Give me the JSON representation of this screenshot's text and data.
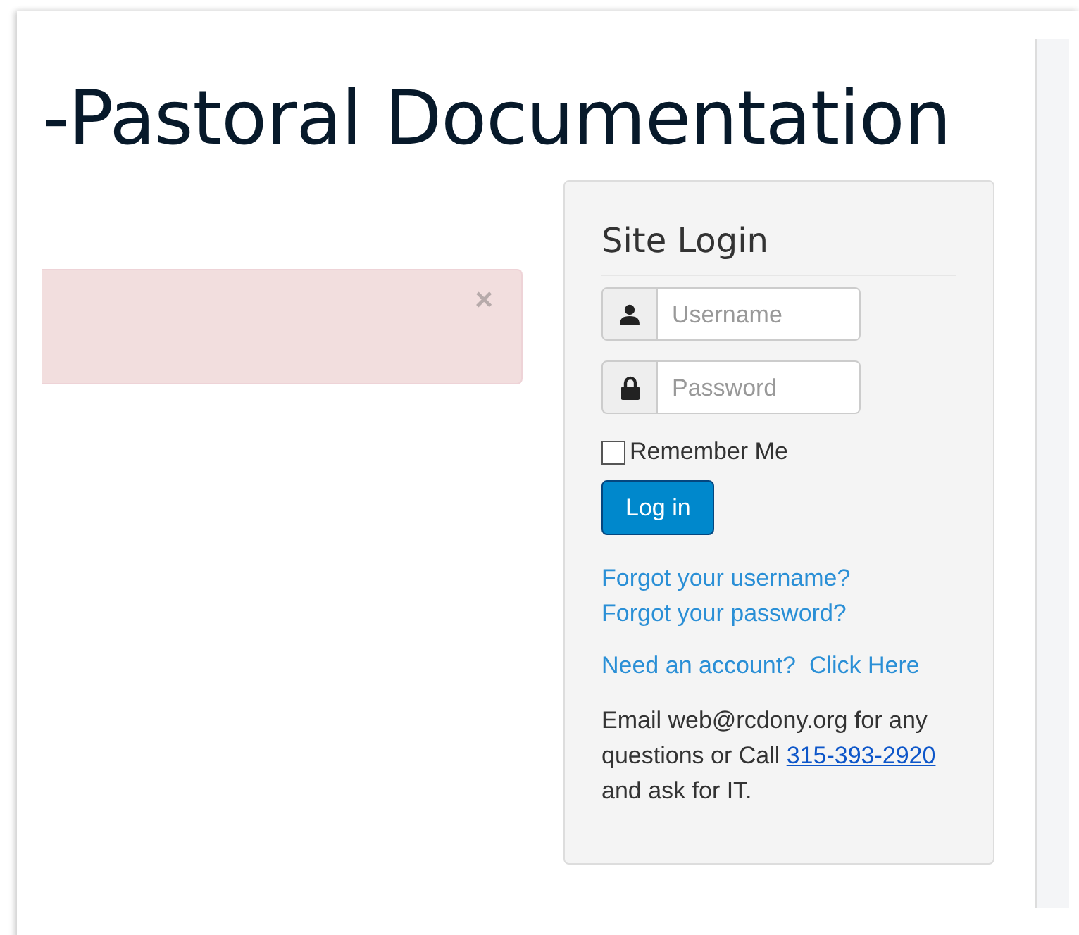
{
  "page_title": "-Pastoral Documentation",
  "alert": {
    "dismissible": true,
    "close_label": "×"
  },
  "login": {
    "title": "Site Login",
    "fields": [
      {
        "kind": "user",
        "placeholder": "Username"
      },
      {
        "kind": "lock",
        "placeholder": "Password"
      }
    ],
    "remember": {
      "label": "Remember Me",
      "checked": false
    },
    "submit": "Log in",
    "links": [
      "Forgot your username?",
      "Forgot your password?"
    ],
    "signup_link": "Need an account?  Click Here",
    "help": {
      "before": "Email web@rcdony.org for any questions or Call ",
      "phone": "315-393-2920",
      "after": " and ask for IT."
    }
  }
}
